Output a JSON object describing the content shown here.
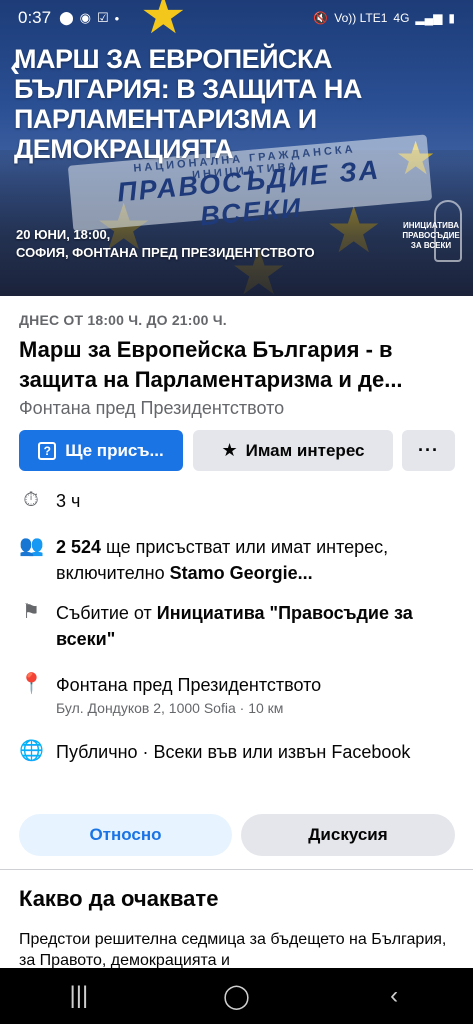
{
  "status_bar": {
    "time": "0:37",
    "network": "Vo)) LTE1",
    "network_type": "4G"
  },
  "cover": {
    "title": "МАРШ ЗА ЕВРОПЕЙСКА БЪЛГАРИЯ: В ЗАЩИТА НА ПАРЛАМЕНТАРИЗМА И ДЕМОКРАЦИЯТА",
    "banner_small": "НАЦИОНАЛНА ГРАЖДАНСКА ИНИЦИАТИВА",
    "banner_big": "ПРАВОСЪДИЕ ЗА ВСЕКИ",
    "info_line1": "20 ЮНИ, 18:00,",
    "info_line2": "СОФИЯ, ФОНТАНА ПРЕД ПРЕЗИДЕНТСТВОТО",
    "org_badge": "ИНИЦИАТИВА ПРАВОСЪДИЕ ЗА ВСЕКИ"
  },
  "event": {
    "when": "ДНЕС ОТ 18:00 Ч. ДО 21:00 Ч.",
    "title_line1": "Марш за Европейска България - в",
    "title_line2": "защита на Парламентаризма и де...",
    "location": "Фонтана пред Президентството"
  },
  "actions": {
    "going_icon": "?",
    "going_label": "Ще присъ...",
    "interested_label": "Имам интерес",
    "more_label": "···"
  },
  "details": {
    "duration": "3 ч",
    "attendees_count": "2 524",
    "attendees_text": " ще присъстват или имат интерес, включително ",
    "attendees_friend": "Stamo Georgie...",
    "host_prefix": "Събитие от ",
    "host_name": "Инициатива \"Правосъдие за всеки\"",
    "place_name": "Фонтана пред Президентството",
    "place_address": "Бул. Дондуков 2, 1000 Sofia · 10 км",
    "privacy": "Публично · Всеки във или извън Facebook"
  },
  "tabs": {
    "about": "Относно",
    "discussion": "Дискусия"
  },
  "expect": {
    "title": "Какво да очаквате",
    "text": "Предстои решителна седмица за бъдещето на България, за Правото, демокрацията и"
  },
  "icons": {
    "accent": "#1b74e4",
    "muted": "#65676b"
  }
}
